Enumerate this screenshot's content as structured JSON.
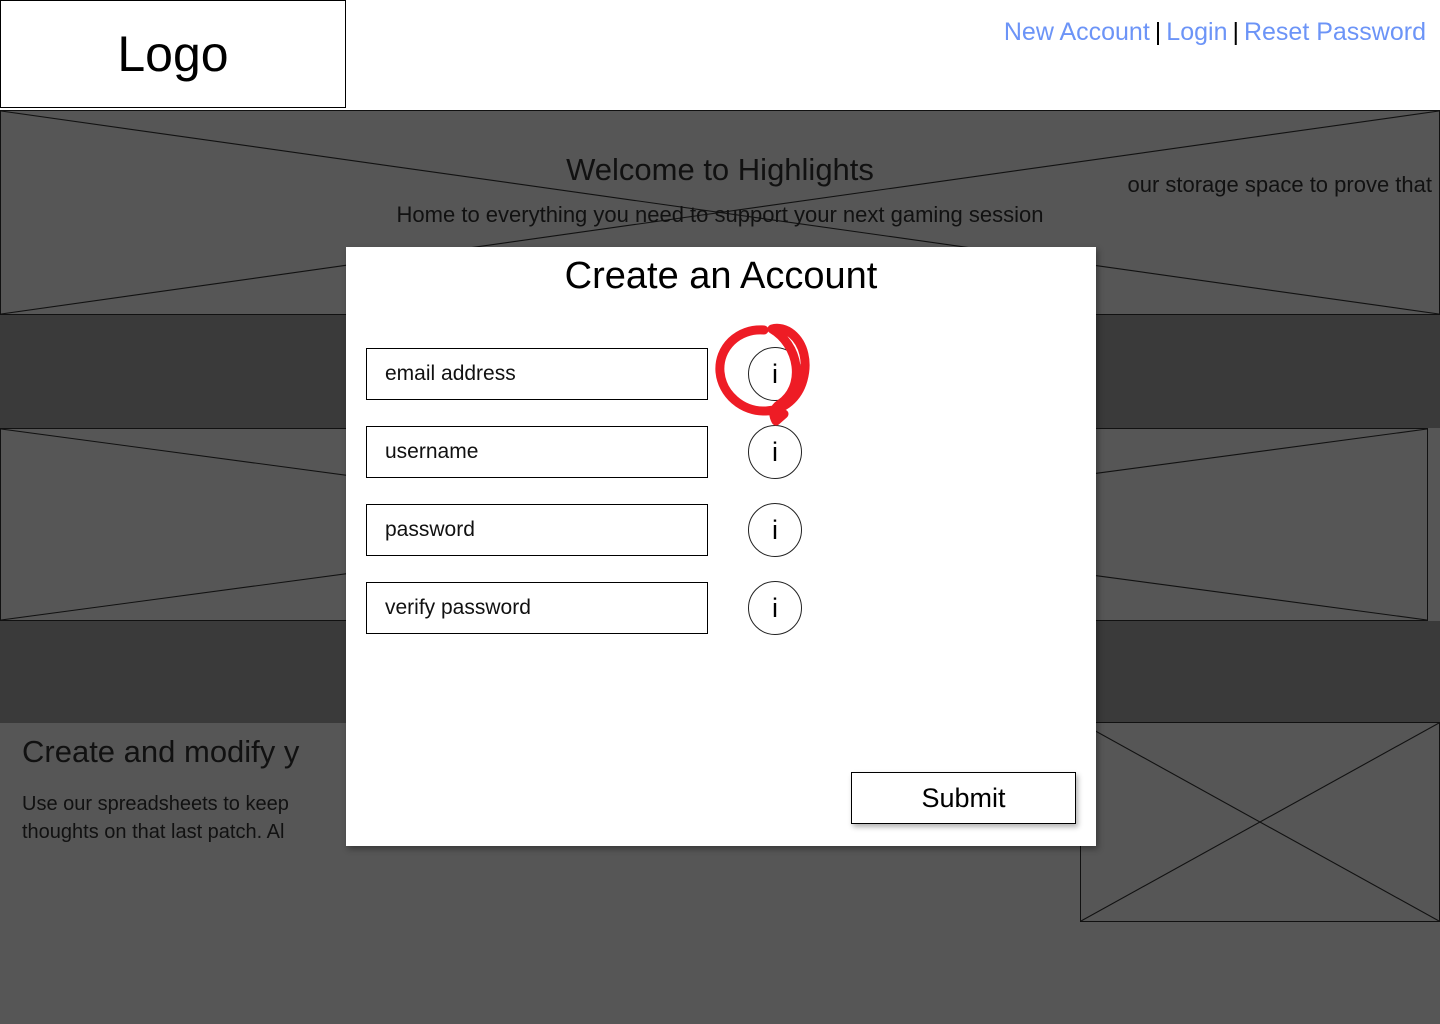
{
  "header": {
    "logo_label": "Logo",
    "nav": [
      {
        "label": "New Account"
      },
      {
        "label": "Login"
      },
      {
        "label": "Reset Password"
      }
    ],
    "separator": "|",
    "link_color": "#6c94f7"
  },
  "hero": {
    "title": "Welcome to Highlights",
    "subtitle": "Home to everything you need to support your next gaming session"
  },
  "background": {
    "middle_text": "our storage space to prove that",
    "lower_title": "Create and modify y",
    "lower_body": "Use our spreadsheets to keep\nthoughts on that last patch. Al",
    "fill_color": "#565656",
    "band_color": "#3a3a3a",
    "line_color": "#111111"
  },
  "modal": {
    "title": "Create an Account",
    "fields": [
      {
        "name": "email",
        "placeholder": "email address",
        "info_glyph": "i"
      },
      {
        "name": "username",
        "placeholder": "username",
        "info_glyph": "i"
      },
      {
        "name": "password",
        "placeholder": "password",
        "info_glyph": "i"
      },
      {
        "name": "verify_password",
        "placeholder": "verify password",
        "info_glyph": "i"
      }
    ],
    "submit_label": "Submit"
  },
  "annotation": {
    "target": "email-info-icon",
    "color": "#ee1c25",
    "shape": "hand-drawn-teardrop-circle"
  }
}
